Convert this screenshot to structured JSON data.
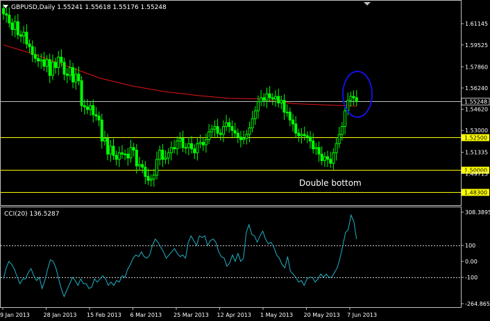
{
  "colors": {
    "background": "#000000",
    "frame": "#c0c0c0",
    "text": "#ffffff",
    "candle_up": "#00ff00",
    "candle_down": "#00ff00",
    "ma_line": "#e81414",
    "horizontal_line": "#ffff00",
    "price_line": "#c0c0c0",
    "annotation_ellipse": "#1212e0",
    "cci_line": "#20b2c8",
    "cci_level": "#d0d0d0",
    "level_label_bg": "#ffff00",
    "price_label_bg": "#000000"
  },
  "main_panel": {
    "header": "GBPUSD,Daily  1.55241 1.55618 1.55176 1.55248",
    "annotation": "Double bottom"
  },
  "cci_panel": {
    "header": "CCI(20) 136.5287"
  },
  "chart_data": [
    {
      "type": "candlestick",
      "symbol": "GBPUSD",
      "timeframe": "Daily",
      "ylim": [
        1.473,
        1.629
      ],
      "y_ticks": [
        "1.61145",
        "1.59525",
        "1.57860",
        "1.56240",
        "1.54620",
        "1.53000",
        "1.51335",
        "1.49715"
      ],
      "current_price": "1.55248",
      "horizontal_levels": [
        "1.52500",
        "1.50000",
        "1.48300"
      ],
      "closes": [
        1.619,
        1.618,
        1.612,
        1.607,
        1.613,
        1.603,
        1.602,
        1.605,
        1.596,
        1.594,
        1.588,
        1.585,
        1.583,
        1.584,
        1.579,
        1.584,
        1.572,
        1.582,
        1.578,
        1.586,
        1.582,
        1.573,
        1.572,
        1.578,
        1.567,
        1.573,
        1.568,
        1.549,
        1.548,
        1.546,
        1.549,
        1.542,
        1.541,
        1.538,
        1.522,
        1.524,
        1.512,
        1.518,
        1.511,
        1.508,
        1.513,
        1.512,
        1.512,
        1.509,
        1.517,
        1.515,
        1.503,
        1.504,
        1.502,
        1.495,
        1.492,
        1.493,
        1.496,
        1.508,
        1.515,
        1.508,
        1.509,
        1.513,
        1.517,
        1.516,
        1.522,
        1.524,
        1.517,
        1.517,
        1.52,
        1.516,
        1.513,
        1.52,
        1.521,
        1.519,
        1.523,
        1.529,
        1.531,
        1.533,
        1.528,
        1.527,
        1.533,
        1.536,
        1.533,
        1.53,
        1.528,
        1.525,
        1.523,
        1.524,
        1.527,
        1.532,
        1.539,
        1.545,
        1.552,
        1.555,
        1.553,
        1.558,
        1.555,
        1.554,
        1.556,
        1.551,
        1.553,
        1.544,
        1.544,
        1.538,
        1.535,
        1.528,
        1.526,
        1.527,
        1.526,
        1.525,
        1.522,
        1.516,
        1.517,
        1.512,
        1.507,
        1.51,
        1.508,
        1.505,
        1.513,
        1.52,
        1.527,
        1.533,
        1.545,
        1.553,
        1.556,
        1.555,
        1.552
      ],
      "ma_line": [
        1.5953,
        1.5878,
        1.579,
        1.57,
        1.564,
        1.5597,
        1.5568,
        1.5546,
        1.554,
        1.5505,
        1.5495,
        1.5485
      ],
      "x_tick_labels": [
        "9 Jan 2013",
        "28 Jan 2013",
        "15 Feb 2013",
        "6 Mar 2013",
        "25 Mar 2013",
        "12 Apr 2013",
        "1 May 2013",
        "20 May 2013",
        "7 Jun 2013"
      ]
    },
    {
      "type": "line",
      "name": "CCI(20)",
      "ylim": [
        -264.8651,
        308.3895
      ],
      "y_ticks": [
        "308.3895",
        "100",
        "0.00",
        "-100",
        "-264.8651"
      ],
      "levels": [
        100,
        -100
      ],
      "values": [
        -110,
        -40,
        0,
        -20,
        -50,
        -100,
        -140,
        -110,
        -110,
        -70,
        -45,
        -90,
        -120,
        -100,
        -170,
        -120,
        -50,
        10,
        0,
        -40,
        -110,
        -175,
        -220,
        -180,
        -140,
        -100,
        -120,
        -150,
        -110,
        -140,
        -140,
        -170,
        -160,
        -110,
        -130,
        -110,
        -90,
        -110,
        -150,
        -130,
        -150,
        -120,
        -130,
        -90,
        -100,
        -50,
        -20,
        20,
        40,
        30,
        60,
        30,
        20,
        40,
        100,
        140,
        120,
        90,
        60,
        20,
        40,
        60,
        80,
        50,
        30,
        40,
        20,
        120,
        160,
        130,
        100,
        160,
        150,
        160,
        100,
        130,
        140,
        120,
        60,
        30,
        20,
        -30,
        -10,
        40,
        0,
        50,
        0,
        20,
        180,
        230,
        170,
        160,
        120,
        160,
        190,
        140,
        110,
        120,
        90,
        40,
        20,
        -20,
        -40,
        30,
        -60,
        -80,
        -100,
        -130,
        -120,
        -150,
        -110,
        -100,
        -100,
        -130,
        -110,
        -80,
        -100,
        -80,
        -100,
        -100,
        -70,
        -40,
        20,
        100,
        180,
        200,
        290,
        250,
        140
      ]
    }
  ]
}
